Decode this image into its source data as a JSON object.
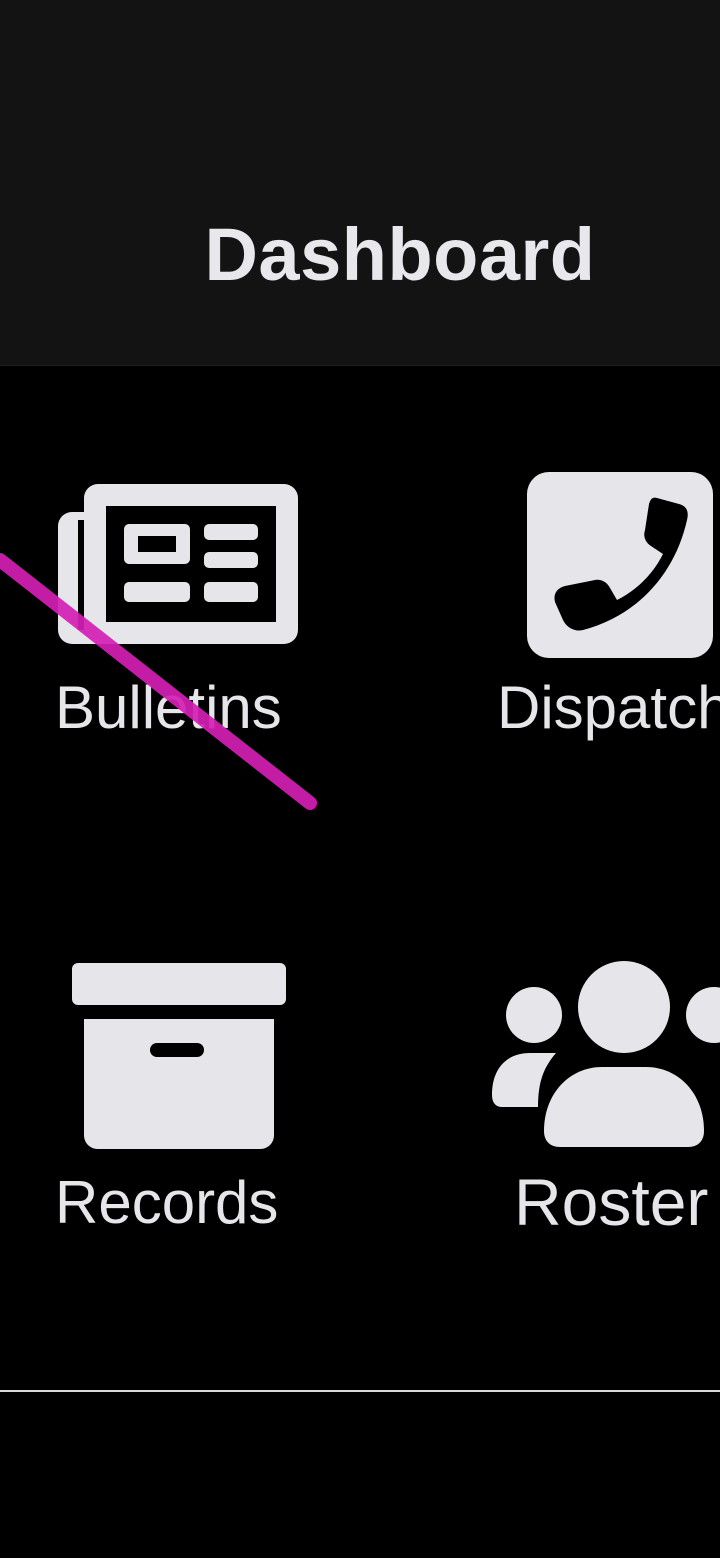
{
  "header": {
    "title": "Dashboard"
  },
  "tiles": [
    {
      "label": "Bulletins",
      "icon": "newspaper-icon"
    },
    {
      "label": "Dispatch",
      "icon": "phone-square-icon"
    },
    {
      "label": "Records",
      "icon": "archive-box-icon"
    },
    {
      "label": "Roster",
      "icon": "users-group-icon"
    }
  ],
  "colors": {
    "background": "#000000",
    "header_background": "#131313",
    "icon": "#e6e6ea",
    "text": "#e8e8ec",
    "annotation_stroke": "#d41fb4"
  }
}
